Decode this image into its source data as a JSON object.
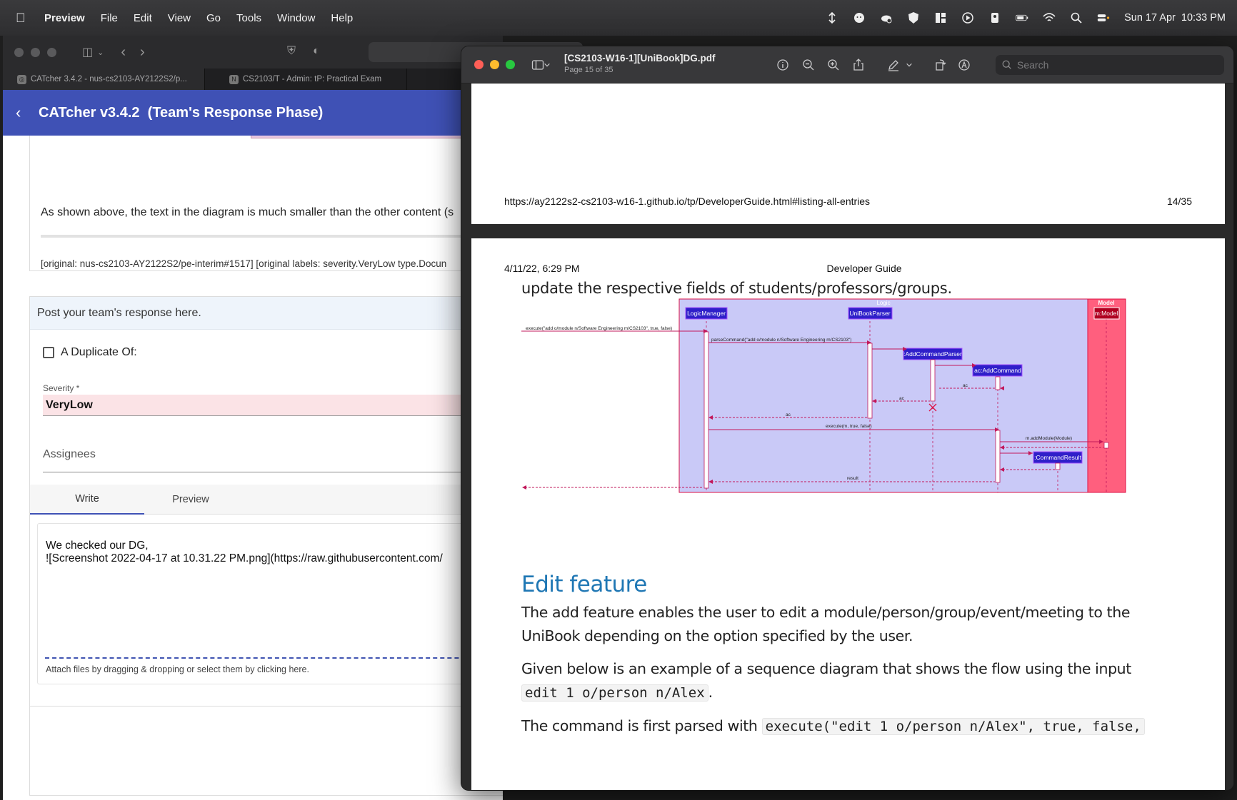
{
  "menubar": {
    "app_name": "Preview",
    "menus": [
      "File",
      "Edit",
      "View",
      "Go",
      "Tools",
      "Window",
      "Help"
    ],
    "clock": "Sun 17 Apr  10:33 PM"
  },
  "browser": {
    "tabs": [
      {
        "label": "CATcher 3.4.2 - nus-cs2103-AY2122S2/p...",
        "icon": "catcher-favicon"
      },
      {
        "label": "CS2103/T - Admin: tP: Practical Exam",
        "icon": "notion-favicon",
        "icon_letter": "N"
      }
    ],
    "header_title": "CATcher v3.4.2  (Team's Response Phase)",
    "para": "As shown above, the text in the diagram is much smaller than the other content (s",
    "original_meta": "[original: nus-cs2103-AY2122S2/pe-interim#1517] [original labels: severity.VeryLow type.Docun",
    "response_header": "Post your team's response here.",
    "duplicate_label": "A Duplicate Of:",
    "severity_label": "Severity *",
    "severity_value": "VeryLow",
    "assignees_label": "Assignees",
    "tab_write": "Write",
    "tab_preview": "Preview",
    "editor_text": "We checked our DG,\n![Screenshot 2022-04-17 at 10.31.22 PM.png](https://raw.githubusercontent.com/",
    "attach_hint": "Attach files by dragging & dropping or select them by clicking here."
  },
  "preview": {
    "doc_title": "[CS2103-W16-1][UniBook]DG.pdf",
    "page_indicator": "Page 15 of 35",
    "search_placeholder": "Search",
    "page1_url": "https://ay2122s2-cs2103-w16-1.github.io/tp/DeveloperGuide.html#listing-all-entries",
    "page1_num": "14/35",
    "page2_date": "4/11/22, 6:29 PM",
    "page2_header": "Developer Guide",
    "page2_line": "update the respective fields of students/professors/groups.",
    "heading": "Edit feature",
    "para1": "The add feature enables the user to edit a module/person/group/event/meeting to the UniBook depending on the option specified by the user.",
    "para2_a": "Given below is an example of a sequence diagram that shows the flow using the input ",
    "para2_code": "edit 1 o/person n/Alex",
    "para2_b": ".",
    "para3_a": "The command is first parsed with ",
    "para3_code": "execute(\"edit 1 o/person n/Alex\", true, false,"
  },
  "diagram": {
    "logic_label": "Logic",
    "model_label": "Model",
    "participants": [
      "LogicManager",
      "UniBookParser",
      ":AddCommandParser",
      "ac:AddCommand",
      ":CommandResult",
      "m:Model"
    ],
    "messages": [
      "execute(\"add o/module n/Software Engineering m/CS2103\", true, false)",
      "parseCommand(\"add o/module n/Software Engineering m/CS2103\")",
      "ac",
      "ac",
      "ac",
      "execute(m, true, false)",
      "m.addModule(Module)",
      "result"
    ],
    "colors": {
      "logic_bg": "#c9c9f7",
      "model_bg": "#ff5f7e",
      "participant": "#2f1fc9",
      "arrow": "#c2185b"
    }
  }
}
